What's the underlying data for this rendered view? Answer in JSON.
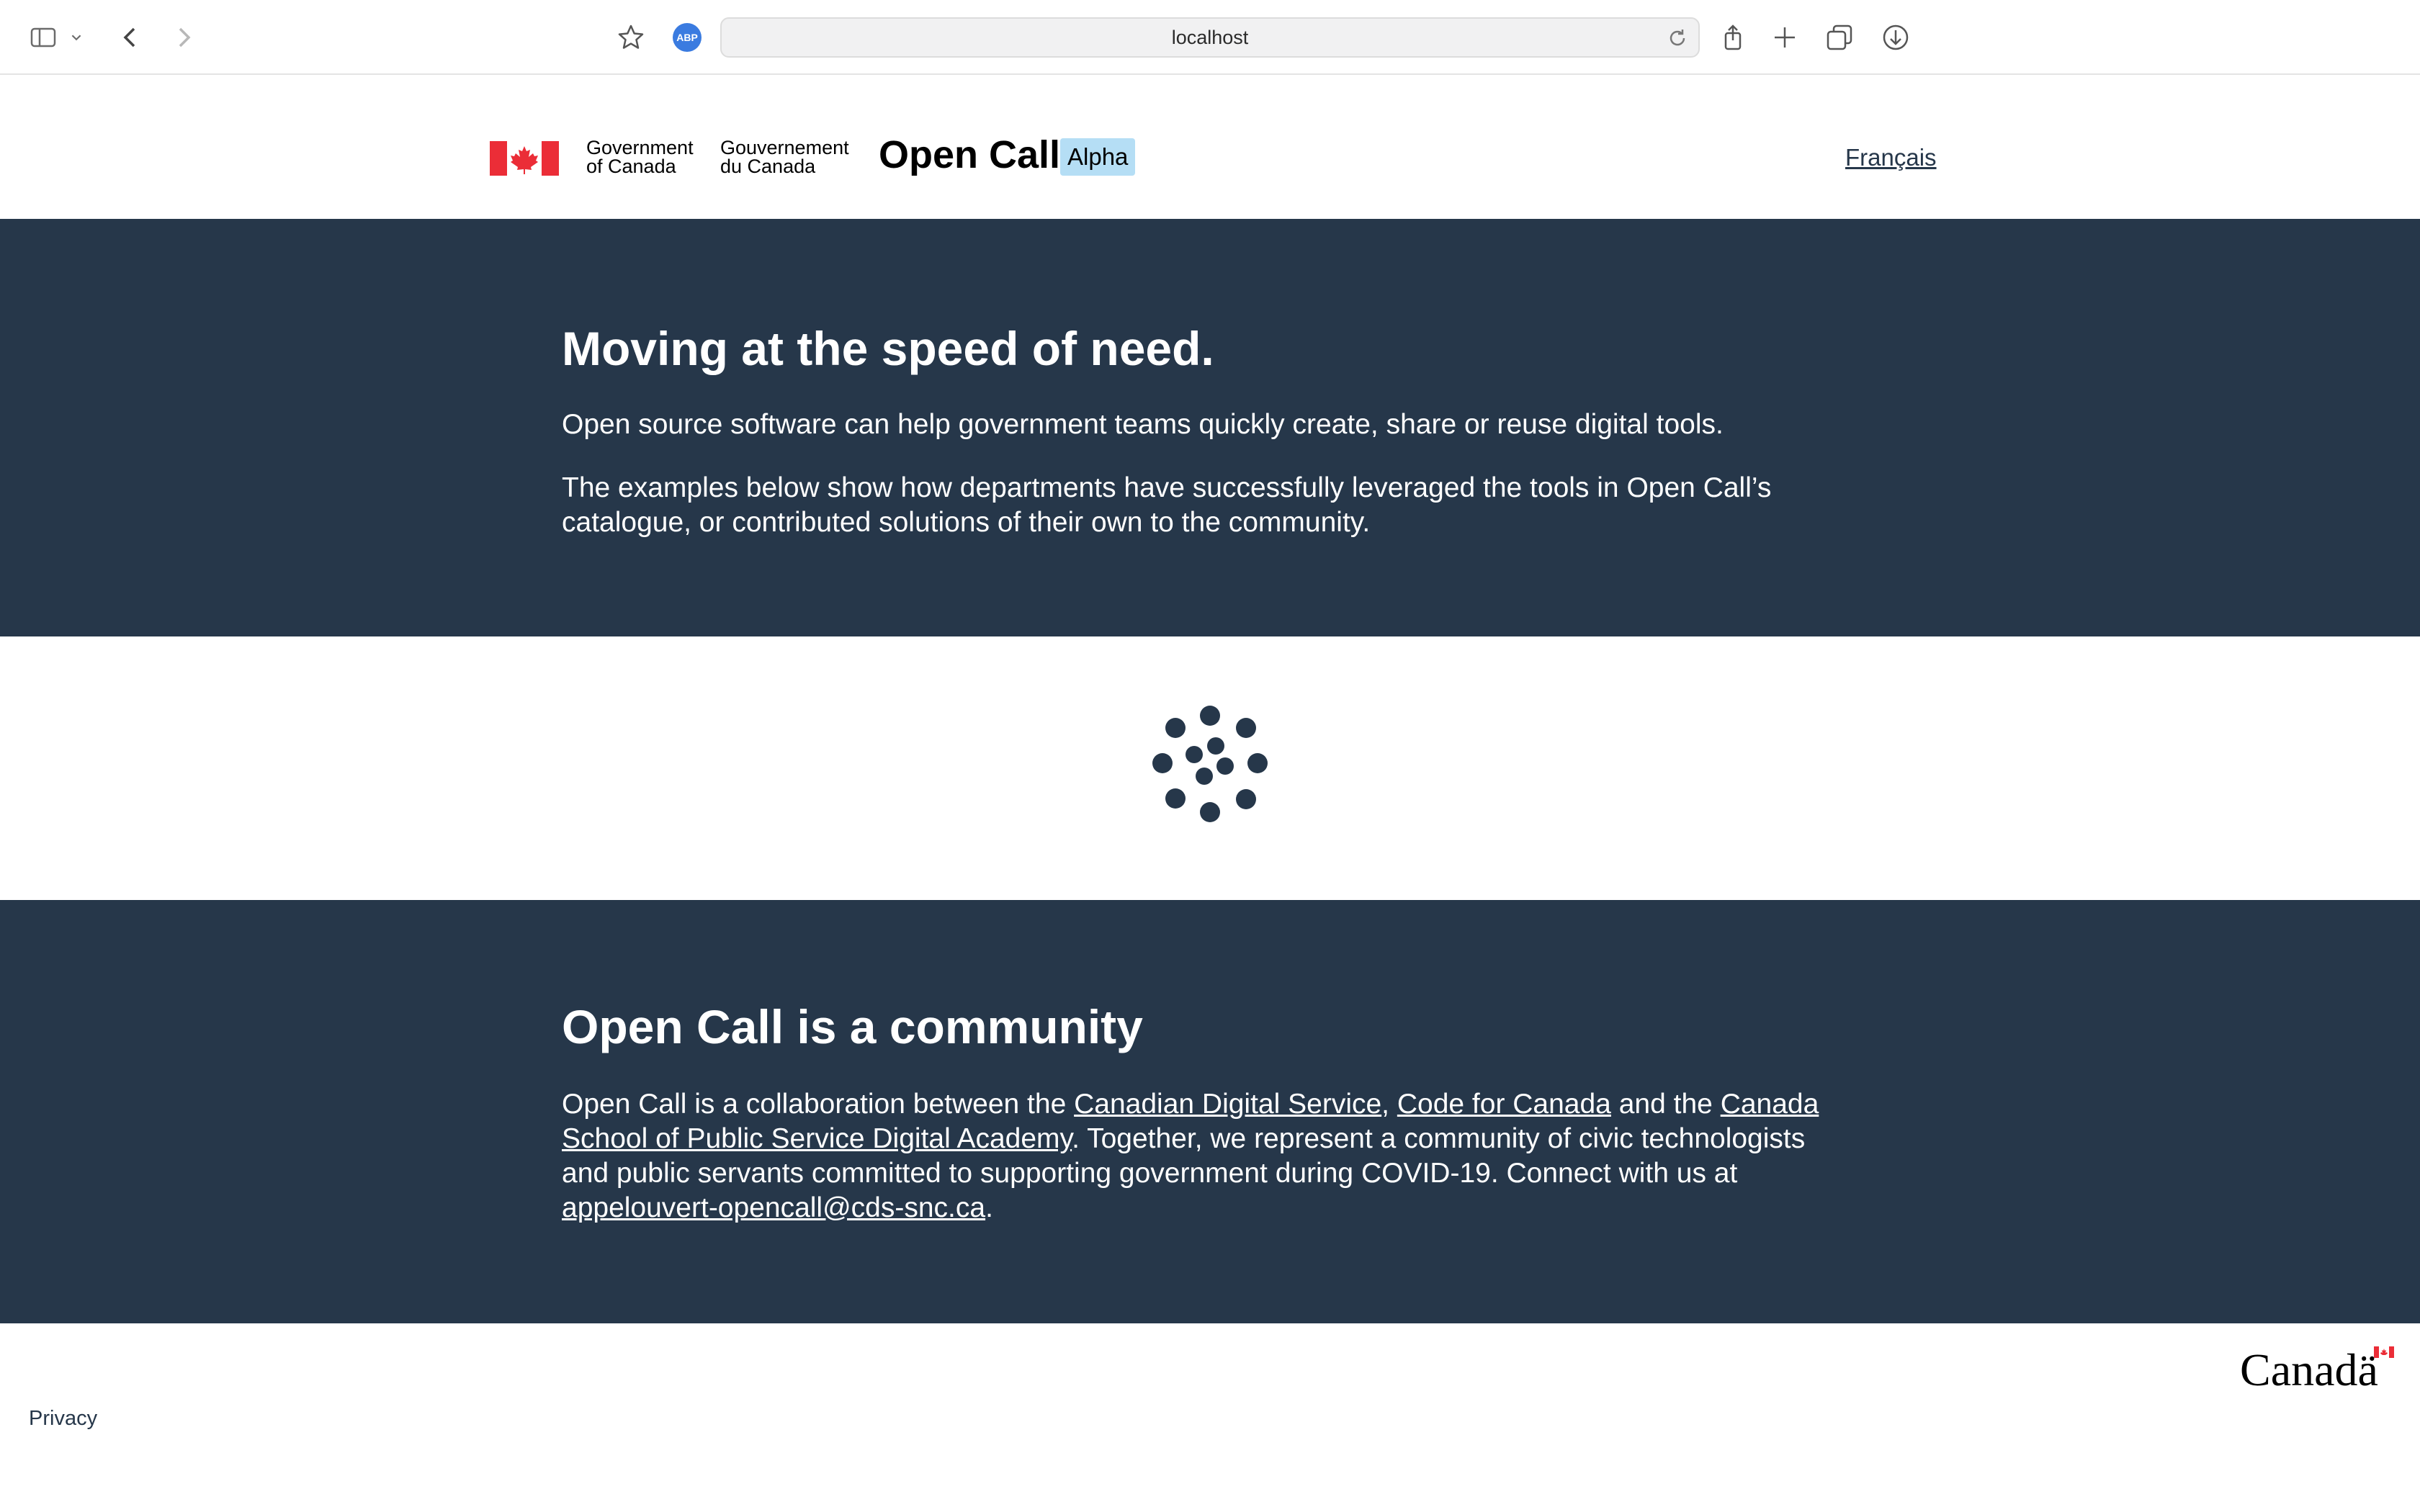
{
  "browser": {
    "url": "localhost"
  },
  "header": {
    "gov_en_line1": "Government",
    "gov_en_line2": "of Canada",
    "gov_fr_line1": "Gouvernement",
    "gov_fr_line2": "du Canada",
    "title": "Open Call",
    "badge": "Alpha",
    "language_link": "Français"
  },
  "hero": {
    "heading": "Moving at the speed of need.",
    "paragraph1": "Open source software can help government teams quickly create, share or reuse digital tools.",
    "paragraph2": "The examples below show how departments have successfully leveraged the tools in Open Call’s catalogue, or contributed solutions of their own to the community."
  },
  "community": {
    "heading": "Open Call is a community",
    "text_intro": "Open Call is a collaboration between the ",
    "link_cds": "Canadian Digital Service",
    "sep1": ", ",
    "link_cfc": "Code for Canada",
    "sep2": " and the ",
    "link_school": "Canada School of Public Service Digital Academy",
    "text_mid": ". Together, we represent a community of civic technologists and public servants committed to supporting government during COVID-19. Connect with us at ",
    "link_email": "appelouvert-opencall@cds-snc.ca",
    "text_end": "."
  },
  "footer": {
    "privacy": "Privacy",
    "wordmark": "Canadä"
  },
  "colors": {
    "brand_dark": "#26374a",
    "badge_bg": "#b5def5",
    "flag_red": "#eb2d37"
  }
}
